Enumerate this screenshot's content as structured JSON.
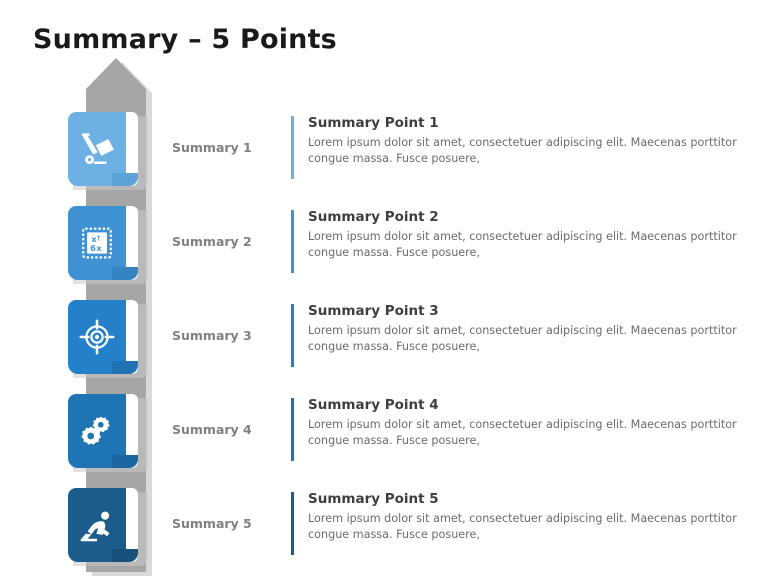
{
  "title": "Summary – 5 Points",
  "palette": {
    "arrow_fill": "#a6a6a6",
    "arrow_edge": "#d9d9d9",
    "label_color": "#808080",
    "heading_color": "#3f3f3f",
    "body_color": "#6b6b6b",
    "title_color": "#1a1a1a"
  },
  "body_text": "Lorem ipsum dolor sit amet, consectetuer adipiscing elit. Maecenas porttitor congue massa. Fusce posuere,",
  "rows": [
    {
      "label": "Summary 1",
      "heading": "Summary Point 1",
      "body": "Lorem ipsum dolor sit amet, consectetuer adipiscing elit. Maecenas porttitor congue massa. Fusce posuere,",
      "color": "#6cb0e4",
      "fold_color": "#5ba2d8",
      "icon": "hand-truck-icon"
    },
    {
      "label": "Summary 2",
      "heading": "Summary Point 2",
      "body": "Lorem ipsum dolor sit amet, consectetuer adipiscing elit. Maecenas porttitor congue massa. Fusce posuere,",
      "color": "#3f92d2",
      "fold_color": "#3484c2",
      "icon": "calculator-math-icon"
    },
    {
      "label": "Summary 3",
      "heading": "Summary Point 3",
      "body": "Lorem ipsum dolor sit amet, consectetuer adipiscing elit. Maecenas porttitor congue massa. Fusce posuere,",
      "color": "#2480c8",
      "fold_color": "#1f73b5",
      "icon": "target-crosshair-icon"
    },
    {
      "label": "Summary 4",
      "heading": "Summary Point 4",
      "body": "Lorem ipsum dolor sit amet, consectetuer adipiscing elit. Maecenas porttitor congue massa. Fusce posuere,",
      "color": "#1f74b4",
      "fold_color": "#1a67a1",
      "icon": "gears-icon"
    },
    {
      "label": "Summary 5",
      "heading": "Summary Point 5",
      "body": "Lorem ipsum dolor sit amet, consectetuer adipiscing elit. Maecenas porttitor congue massa. Fusce posuere,",
      "color": "#1b5c8c",
      "fold_color": "#17517b",
      "icon": "runner-start-icon"
    }
  ]
}
